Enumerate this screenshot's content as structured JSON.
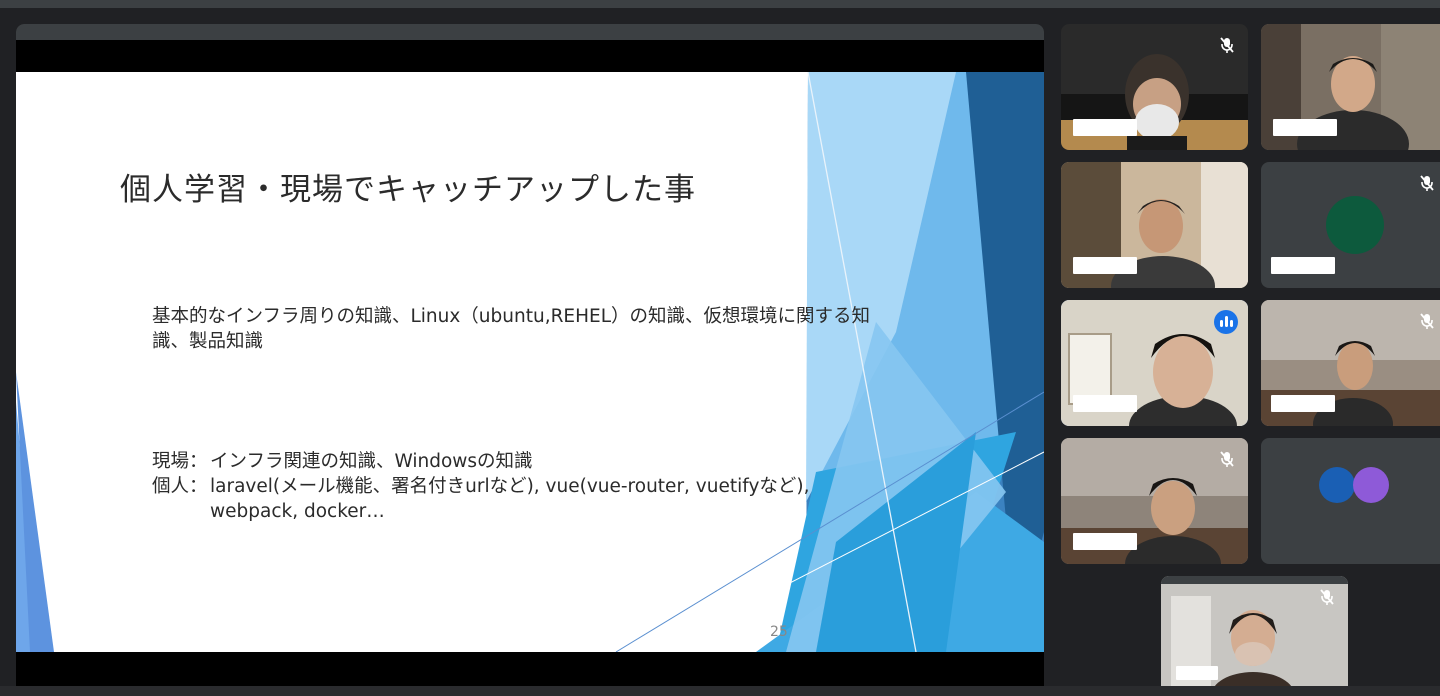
{
  "slide": {
    "title": "個人学習・現場でキャッチアップした事",
    "paragraph1": "基本的なインフラ周りの知識、Linux（ubuntu,REHEL）の知識、仮想環境に関する知識、製品知識",
    "genba_label": "現場：",
    "genba_text": "インフラ関連の知識、Windowsの知識",
    "kojin_label": "個人：",
    "kojin_text": "laravel(メール機能、署名付きurlなど), vue(vue-router, vuetifyなど),",
    "kojin_text2": "webpack, docker…",
    "page_number": "25"
  },
  "participants": [
    {
      "muted": true,
      "speaking": false,
      "video": true
    },
    {
      "muted": false,
      "speaking": false,
      "video": true
    },
    {
      "muted": false,
      "speaking": false,
      "video": true
    },
    {
      "muted": true,
      "speaking": false,
      "video": false,
      "avatar_color": "#0d5a3d"
    },
    {
      "muted": false,
      "speaking": true,
      "video": true
    },
    {
      "muted": true,
      "speaking": false,
      "video": true
    },
    {
      "muted": true,
      "speaking": false,
      "video": true
    },
    {
      "muted": false,
      "speaking": false,
      "video": false,
      "avatar_colors": [
        "#1a5fb4",
        "#8e5ad8"
      ]
    },
    {
      "muted": true,
      "speaking": false,
      "video": true
    }
  ],
  "colors": {
    "background": "#202124",
    "tile": "#3c4043",
    "active_border": "#8ab4f8",
    "speaking": "#1a73e8"
  }
}
